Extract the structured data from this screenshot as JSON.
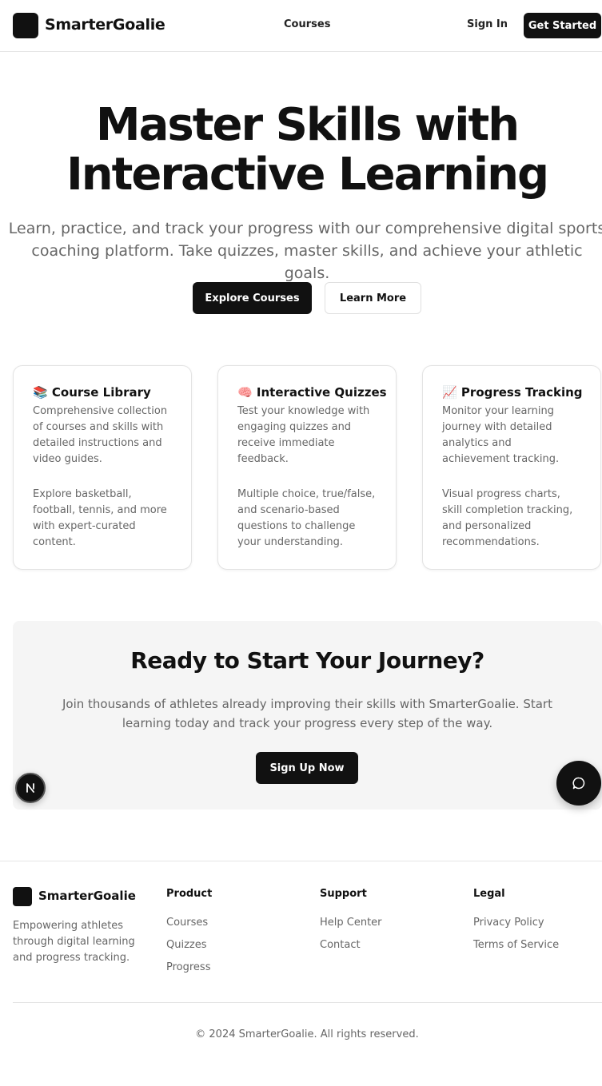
{
  "header": {
    "brand": "SmarterGoalie",
    "nav_courses": "Courses",
    "sign_in": "Sign In",
    "get_started": "Get Started"
  },
  "hero": {
    "title_line1": "Master Skills with",
    "title_line2": "Interactive Learning",
    "subtitle": "Learn, practice, and track your progress with our comprehensive digital sports coaching platform. Take quizzes, master skills, and achieve your athletic goals.",
    "explore_button": "Explore Courses",
    "learn_more_button": "Learn More"
  },
  "features": [
    {
      "emoji": "📚",
      "title": "Course Library",
      "description": "Comprehensive collection of courses and skills with detailed instructions and video guides.",
      "detail": "Explore basketball, football, tennis, and more with expert-curated content."
    },
    {
      "emoji": "🧠",
      "title": "Interactive Quizzes",
      "description": "Test your knowledge with engaging quizzes and receive immediate feedback.",
      "detail": "Multiple choice, true/false, and scenario-based questions to challenge your understanding."
    },
    {
      "emoji": "📈",
      "title": "Progress Tracking",
      "description": "Monitor your learning journey with detailed analytics and achievement tracking.",
      "detail": "Visual progress charts, skill completion tracking, and personalized recommendations."
    }
  ],
  "cta": {
    "title": "Ready to Start Your Journey?",
    "subtitle": "Join thousands of athletes already improving their skills with SmarterGoalie. Start learning today and track your progress every step of the way.",
    "button": "Sign Up Now"
  },
  "floating": {
    "badge_letter": "N",
    "badge_icon": "nextjs-icon",
    "chat_icon": "chat-bubble-icon"
  },
  "footer": {
    "brand": "SmarterGoalie",
    "tagline": "Empowering athletes through digital learning and progress tracking.",
    "columns": [
      {
        "title": "Product",
        "links": [
          "Courses",
          "Quizzes",
          "Progress"
        ]
      },
      {
        "title": "Support",
        "links": [
          "Help Center",
          "Contact"
        ]
      },
      {
        "title": "Legal",
        "links": [
          "Privacy Policy",
          "Terms of Service"
        ]
      }
    ],
    "copyright": "© 2024 SmarterGoalie. All rights reserved."
  },
  "colors": {
    "primary": "#111111",
    "muted_text": "#666666",
    "border": "#e5e5e5",
    "cta_background": "#f5f5f5"
  }
}
